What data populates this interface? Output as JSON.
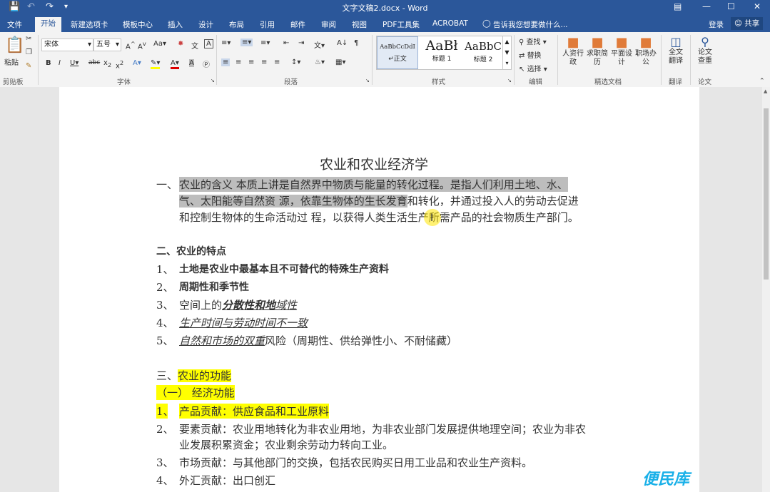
{
  "titlebar": {
    "title": "文字文稿2.docx - Word",
    "login": "登录",
    "share": "共享"
  },
  "tabs": [
    "文件",
    "开始",
    "新建选项卡",
    "模板中心",
    "插入",
    "设计",
    "布局",
    "引用",
    "邮件",
    "审阅",
    "视图",
    "PDF工具集",
    "ACROBAT"
  ],
  "tell_me": "告诉我您想要做什么...",
  "ribbon": {
    "clipboard": {
      "paste": "粘贴",
      "label": "剪贴板"
    },
    "font": {
      "name": "宋体",
      "size": "五号",
      "label": "字体"
    },
    "paragraph": {
      "label": "段落"
    },
    "styles": {
      "label": "样式",
      "items": [
        {
          "preview": "AaBbCcDdI",
          "name": "正文"
        },
        {
          "preview": "AaBł",
          "name": "标题 1"
        },
        {
          "preview": "AaBbC",
          "name": "标题 2"
        }
      ]
    },
    "editing": {
      "find": "查找",
      "replace": "替换",
      "select": "选择",
      "label": "编辑"
    },
    "docs": {
      "label": "精选文档",
      "items": [
        "人资行政",
        "求职简历",
        "平面设计",
        "职场办公"
      ]
    },
    "translate": {
      "item": "全文翻译",
      "label": "翻译"
    },
    "paper": {
      "item": "论文查重",
      "label": "论文"
    }
  },
  "document": {
    "title": "农业和农业经济学",
    "s1_num": "一、",
    "s1_l1": "农业的含义 本质上讲是自然界中物质与能量的转化过程。是指人们利用土地、水、",
    "s1_l2a": "气、太阳能等自然资 源，依靠生物体的生长发育",
    "s1_l2b": "和转化，并通过投入人的劳动去促进",
    "s1_l3": "和控制生物体的生命活动过 程，以获得人类生活生产所需产品的社会物质生产部门。",
    "s2_head": "二、农业的特点",
    "s2_items": [
      {
        "n": "1、",
        "t": "土地是农业中最基本且不可替代的特殊生产资料"
      },
      {
        "n": "2、",
        "t": "周期性和季节性"
      },
      {
        "n": "3、",
        "a": "空间上的",
        "b": "分散性和地",
        "c": "域性"
      },
      {
        "n": "4、",
        "t": "生产时间与劳动时间不一致"
      },
      {
        "n": "5、",
        "a": "自然和市场的双重",
        "b": "风险（周期性、供给弹性小、不耐储藏）"
      }
    ],
    "s3_head_a": "三、",
    "s3_head_b": "农业的功能",
    "s3_sub": "（一） 经济功能",
    "s3_items": [
      {
        "n": "1、",
        "t": "产品贡献：供应食品和工业原料"
      },
      {
        "n": "2、",
        "t": "要素贡献：农业用地转化为非农业用地，为非农业部门发展提供地理空间；农业为非农",
        "t2": "业发展积累资金；农业剩余劳动力转向工业。"
      },
      {
        "n": "3、",
        "t": "市场贡献：与其他部门的交换，包括农民购买日用工业品和农业生产资料。"
      },
      {
        "n": "4、",
        "t": "外汇贡献：出口创汇"
      }
    ]
  },
  "watermark": "便民库"
}
